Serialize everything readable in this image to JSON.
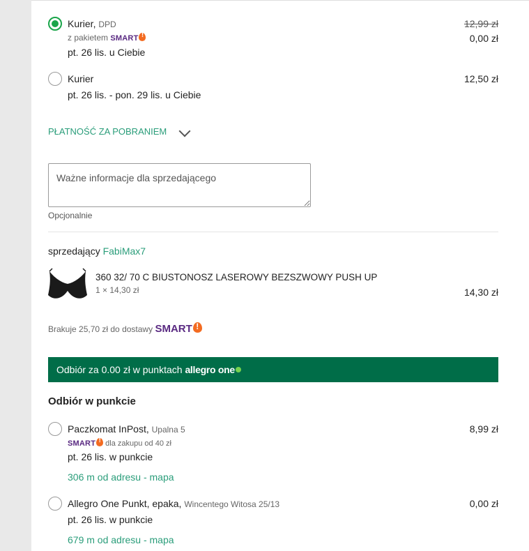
{
  "shipping_options": [
    {
      "name": "Kurier,",
      "carrier": "DPD",
      "smart_prefix": "z pakietem",
      "smart_label": "SMART",
      "delivery": "pt. 26 lis. u Ciebie",
      "old_price": "12,99 zł",
      "price": "0,00 zł",
      "selected": true
    },
    {
      "name": "Kurier",
      "delivery": "pt. 26 lis. - pon. 29 lis. u Ciebie",
      "price": "12,50 zł",
      "selected": false
    }
  ],
  "cod_toggle": "PŁATNOŚĆ ZA POBRANIEM",
  "note": {
    "placeholder": "Ważne informacje dla sprzedającego",
    "hint": "Opcjonalnie"
  },
  "seller": {
    "prefix": "sprzedający",
    "name": "FabiMax7"
  },
  "product": {
    "title": "360 32/ 70 C BIUSTONOSZ LASEROWY BEZSZWOWY PUSH UP",
    "quantity_price": "1 × 14,30 zł",
    "total": "14,30 zł"
  },
  "smart_missing": {
    "text": "Brakuje 25,70 zł do dostawy",
    "label": "SMART"
  },
  "banner": {
    "text": "Odbiór za 0.00 zł w punktach",
    "brand": "allegro one"
  },
  "pickup_section_title": "Odbiór w punkcie",
  "pickup_options": [
    {
      "name": "Paczkomat InPost,",
      "address": "Upalna 5",
      "smart_label": "SMART",
      "smart_note": "dla zakupu od 40 zł",
      "delivery": "pt. 26 lis. w punkcie",
      "distance_link": "306 m od adresu - mapa",
      "price": "8,99 zł",
      "selected": false
    },
    {
      "name": "Allegro One Punkt, epaka,",
      "address": "Wincentego Witosa 25/13",
      "delivery": "pt. 26 lis. w punkcie",
      "distance_link": "679 m od adresu - mapa",
      "price": "0,00 zł",
      "selected": false
    }
  ],
  "colors": {
    "accent_green": "#1aa54a",
    "link_teal": "#2a9d7a",
    "banner_green": "#006d48",
    "smart_purple": "#5a2a82",
    "smart_orange": "#f36b21"
  }
}
